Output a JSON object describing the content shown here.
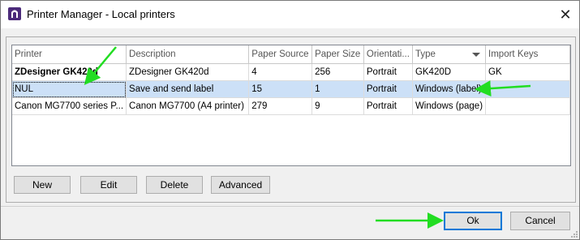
{
  "window": {
    "title": "Printer Manager - Local printers",
    "close_glyph": "✕",
    "app_icon": "niceLabel-n-icon"
  },
  "grid": {
    "columns": [
      "Printer",
      "Description",
      "Paper Source",
      "Paper Size",
      "Orientati...",
      "Type",
      "Import Keys"
    ],
    "sort_column": "Type",
    "rows": [
      {
        "printer": "ZDesigner GK420d",
        "description": "ZDesigner GK420d",
        "paper_source": "4",
        "paper_size": "256",
        "orientation": "Portrait",
        "type": "GK420D",
        "import_keys": "GK"
      },
      {
        "printer": "NUL",
        "description": "Save and send label",
        "paper_source": "15",
        "paper_size": "1",
        "orientation": "Portrait",
        "type": "Windows (label)",
        "import_keys": ""
      },
      {
        "printer": "Canon MG7700 series P...",
        "description": "Canon MG7700 (A4 printer)",
        "paper_source": "279",
        "paper_size": "9",
        "orientation": "Portrait",
        "type": "Windows (page)",
        "import_keys": ""
      }
    ],
    "selected_row": 1
  },
  "actions": {
    "new": "New",
    "edit": "Edit",
    "delete": "Delete",
    "advanced": "Advanced"
  },
  "footer": {
    "ok": "Ok",
    "cancel": "Cancel"
  },
  "colors": {
    "selection": "#cce0f7",
    "annotation_arrow": "#22dd22",
    "default_button_border": "#0078d7",
    "app_icon": "#4b2a7a"
  }
}
